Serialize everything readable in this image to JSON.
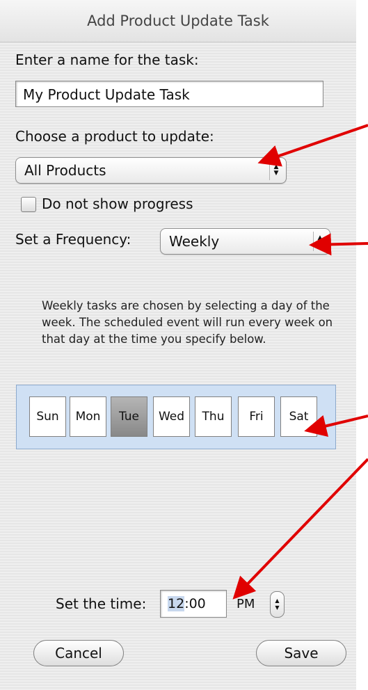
{
  "window": {
    "title": "Add Product Update Task"
  },
  "task_name": {
    "label": "Enter a name for the task:",
    "value": "My Product Update Task"
  },
  "product": {
    "label": "Choose a product to update:",
    "selected": "All Products"
  },
  "progress_checkbox": {
    "label": "Do not show progress",
    "checked": false
  },
  "frequency": {
    "label": "Set a Frequency:",
    "selected": "Weekly"
  },
  "description": "Weekly tasks are chosen by selecting a day of the week.  The scheduled event will run every week on that day at the time you specify below.",
  "days": [
    "Sun",
    "Mon",
    "Tue",
    "Wed",
    "Thu",
    "Fri",
    "Sat"
  ],
  "selected_day": "Tue",
  "time": {
    "label": "Set the time:",
    "hour": "12",
    "separator": ":",
    "minute": "00",
    "ampm": "PM"
  },
  "buttons": {
    "cancel": "Cancel",
    "save": "Save"
  },
  "colors": {
    "annotation_arrow": "#e00000",
    "day_panel": "#cfe0f4",
    "selected_day": "#9a9a9a"
  }
}
